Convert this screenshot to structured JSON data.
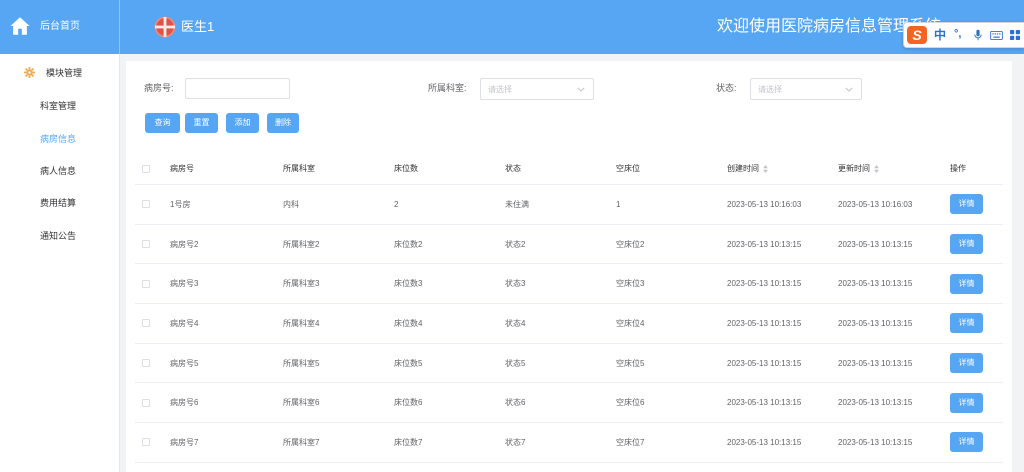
{
  "theme": {
    "primary": "#56a6f4",
    "active": "#56a6f4",
    "accent": "#f5a54a",
    "ime_logo": "#f26522",
    "ime_icon": "#2b6fd6"
  },
  "icons": {
    "brand": "home-icon",
    "avatar": "avatar-icon",
    "sidebar_group": "gear-icon",
    "select": "chevron-down-icon",
    "sort": "sort-icon",
    "ime": [
      "microphone-icon",
      "keyboard-icon",
      "toolbox-icon"
    ]
  },
  "header": {
    "brand": "后台首页",
    "user": "医生1",
    "welcome": "欢迎使用医院病房信息管理系统"
  },
  "ime": {
    "logo": "S",
    "lang": "中",
    "punct": "°,"
  },
  "sidebar": {
    "group": "模块管理",
    "items": [
      {
        "label": "科室管理",
        "active": false
      },
      {
        "label": "病房信息",
        "active": true
      },
      {
        "label": "病人信息",
        "active": false
      },
      {
        "label": "费用结算",
        "active": false
      },
      {
        "label": "通知公告",
        "active": false
      }
    ]
  },
  "filters": {
    "room_no": {
      "label": "病房号:",
      "value": ""
    },
    "department": {
      "label": "所属科室:",
      "placeholder": "请选择"
    },
    "status": {
      "label": "状态:",
      "placeholder": "请选择"
    }
  },
  "actions": {
    "search": "查询",
    "reset": "重置",
    "add": "添加",
    "delete": "删除"
  },
  "table": {
    "columns": [
      "病房号",
      "所属科室",
      "床位数",
      "状态",
      "空床位",
      "创建时间",
      "更新时间",
      "操作"
    ],
    "rows": [
      {
        "room": "1号房",
        "department": "内科",
        "beds": "2",
        "status": "未住满",
        "free_beds": "1",
        "created": "2023-05-13 10:16:03",
        "updated": "2023-05-13 10:16:03",
        "action": "详情"
      },
      {
        "room": "病房号2",
        "department": "所属科室2",
        "beds": "床位数2",
        "status": "状态2",
        "free_beds": "空床位2",
        "created": "2023-05-13 10:13:15",
        "updated": "2023-05-13 10:13:15",
        "action": "详情"
      },
      {
        "room": "病房号3",
        "department": "所属科室3",
        "beds": "床位数3",
        "status": "状态3",
        "free_beds": "空床位3",
        "created": "2023-05-13 10:13:15",
        "updated": "2023-05-13 10:13:15",
        "action": "详情"
      },
      {
        "room": "病房号4",
        "department": "所属科室4",
        "beds": "床位数4",
        "status": "状态4",
        "free_beds": "空床位4",
        "created": "2023-05-13 10:13:15",
        "updated": "2023-05-13 10:13:15",
        "action": "详情"
      },
      {
        "room": "病房号5",
        "department": "所属科室5",
        "beds": "床位数5",
        "status": "状态5",
        "free_beds": "空床位5",
        "created": "2023-05-13 10:13:15",
        "updated": "2023-05-13 10:13:15",
        "action": "详情"
      },
      {
        "room": "病房号6",
        "department": "所属科室6",
        "beds": "床位数6",
        "status": "状态6",
        "free_beds": "空床位6",
        "created": "2023-05-13 10:13:15",
        "updated": "2023-05-13 10:13:15",
        "action": "详情"
      },
      {
        "room": "病房号7",
        "department": "所属科室7",
        "beds": "床位数7",
        "status": "状态7",
        "free_beds": "空床位7",
        "created": "2023-05-13 10:13:15",
        "updated": "2023-05-13 10:13:15",
        "action": "详情"
      }
    ]
  }
}
